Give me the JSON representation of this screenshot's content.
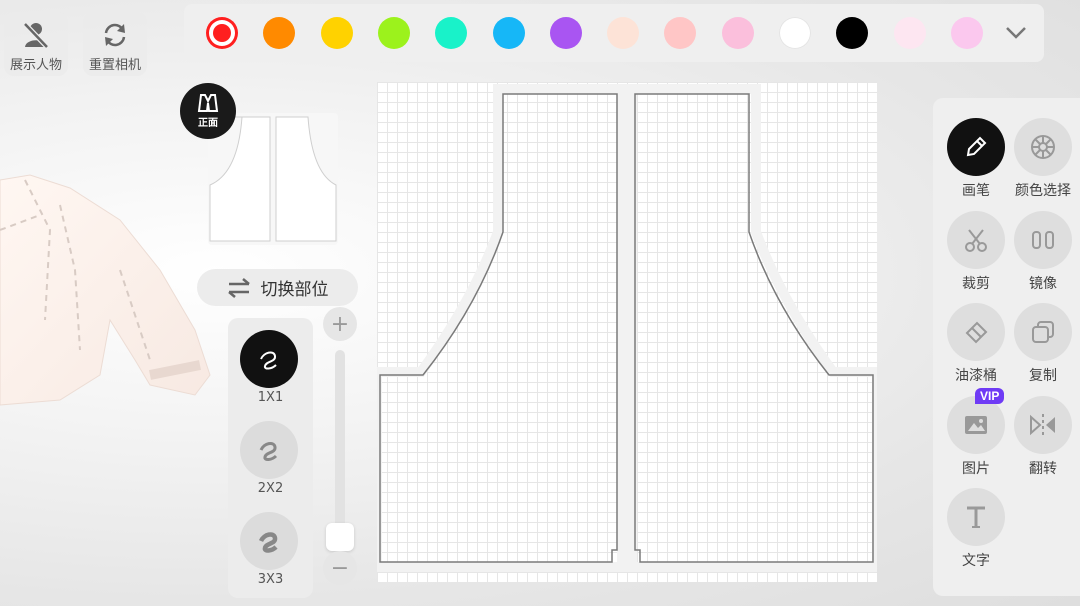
{
  "top_left": {
    "show_character": "展示人物",
    "reset_camera": "重置相机"
  },
  "palette": {
    "swatches": [
      "#ff1f1f",
      "#ff8a00",
      "#ffd200",
      "#9cf21c",
      "#19f2c9",
      "#16b7f7",
      "#a955f2",
      "#fde3d7",
      "#ffc6c6",
      "#fbbfdc",
      "#ffffff",
      "#000000",
      "#fde6f1",
      "#fbc8ee"
    ],
    "selected": "#ff1f1f",
    "expand_icon": "chevron-down-icon"
  },
  "preview": {
    "badge_label": "正面"
  },
  "switch_part": {
    "label": "切换部位"
  },
  "brushes": [
    {
      "label": "1X1",
      "active": true
    },
    {
      "label": "2X2",
      "active": false
    },
    {
      "label": "3X3",
      "active": false
    }
  ],
  "slider": {
    "plus": "+",
    "minus": "−",
    "level": 0.0
  },
  "tools": {
    "brush": "画笔",
    "color_picker": "颜色选择",
    "crop": "裁剪",
    "mirror": "镜像",
    "paint_bucket": "油漆桶",
    "copy": "复制",
    "image": "图片",
    "flip": "翻转",
    "text": "文字",
    "vip": "VIP"
  }
}
